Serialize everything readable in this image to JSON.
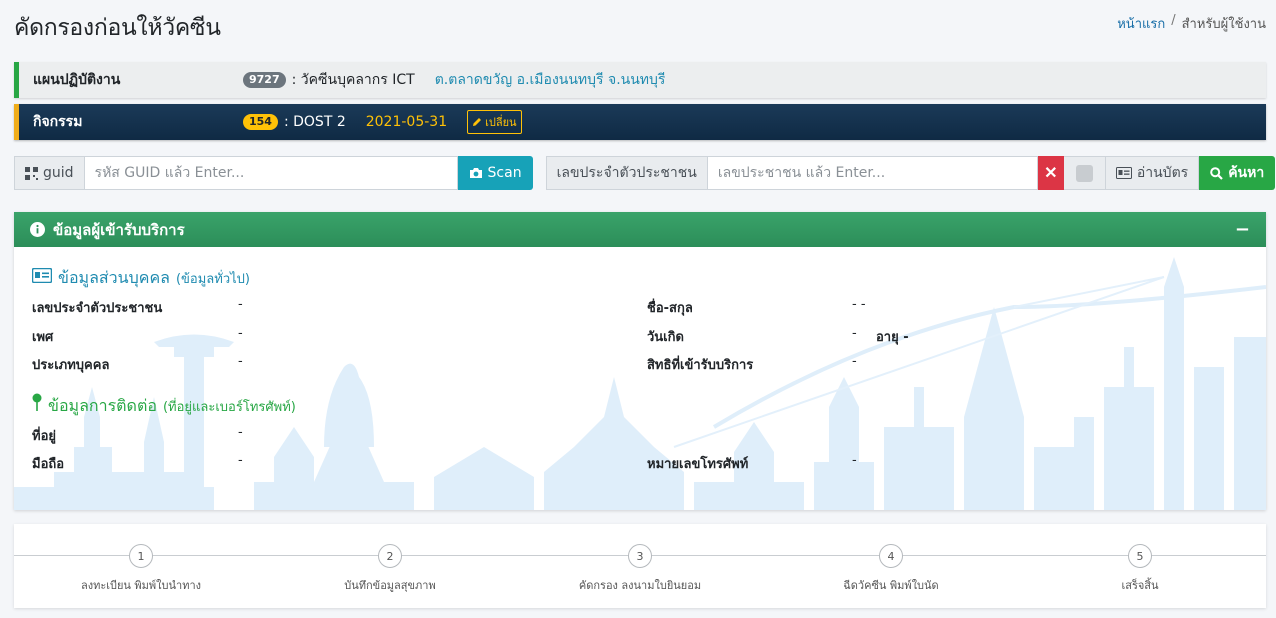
{
  "page": {
    "title": "คัดกรองก่อนให้วัคซีน"
  },
  "breadcrumb": {
    "home": "หน้าแรก",
    "separator": "/",
    "current": "สำหรับผู้ใช้งาน"
  },
  "plan": {
    "label": "แผนปฏิบัติงาน",
    "badge": "9727",
    "name": ": วัคซีนบุคลากร ICT",
    "location": "ต.ตลาดขวัญ อ.เมืองนนทบุรี จ.นนทบุรี"
  },
  "activity": {
    "label": "กิจกรรม",
    "badge": "154",
    "name": ": DOST 2",
    "date": "2021-05-31",
    "change_label": "เปลี่ยน"
  },
  "search": {
    "guid_label": "guid",
    "guid_placeholder": "รหัส GUID แล้ว Enter...",
    "scan_label": "Scan",
    "cid_label": "เลขประจำตัวประชาชน",
    "cid_placeholder": "เลขประชาชน แล้ว Enter...",
    "clear_label": "✕",
    "read_card_label": "อ่านบัตร",
    "search_label": "ค้นหา"
  },
  "card": {
    "title": "ข้อมูลผู้เข้ารับบริการ",
    "collapse_label": "−",
    "personal": {
      "title": "ข้อมูลส่วนบุคคล",
      "subtitle": "(ข้อมูลทั่วไป)",
      "cid_label": "เลขประจำตัวประชาชน",
      "cid_value": "-",
      "name_label": "ชื่อ-สกุล",
      "name_value": "- -",
      "sex_label": "เพศ",
      "sex_value": "-",
      "dob_label": "วันเกิด",
      "dob_value": "-",
      "age_value": "อายุ -",
      "type_label": "ประเภทบุคคล",
      "type_value": "-",
      "right_label": "สิทธิที่เข้ารับบริการ",
      "right_value": "-"
    },
    "contact": {
      "title": "ข้อมูลการติดต่อ",
      "subtitle": "(ที่อยู่และเบอร์โทรศัพท์)",
      "address_label": "ที่อยู่",
      "address_value": "-",
      "mobile_label": "มือถือ",
      "mobile_value": "-",
      "phone_label": "หมายเลขโทรศัพท์",
      "phone_value": "-"
    }
  },
  "steps": [
    {
      "num": "1",
      "label": "ลงทะเบียน พิมพ์ใบนำทาง"
    },
    {
      "num": "2",
      "label": "บันทึกข้อมูลสุขภาพ"
    },
    {
      "num": "3",
      "label": "คัดกรอง ลงนามใบยินยอม"
    },
    {
      "num": "4",
      "label": "ฉีดวัคซีน พิมพ์ใบนัด"
    },
    {
      "num": "5",
      "label": "เสร็จสิ้น"
    }
  ],
  "colors": {
    "primary_green": "#28a745",
    "info_blue": "#17a2b8",
    "navy": "#0f2a44",
    "warning": "#ffc107",
    "danger": "#dc3545"
  }
}
